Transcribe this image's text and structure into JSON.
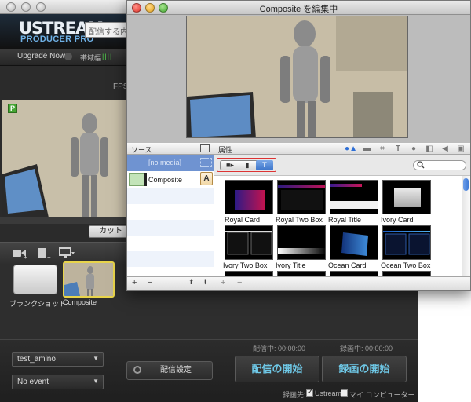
{
  "app": {
    "logo_main": "USTREAM",
    "logo_sub": "PRODUCER PRO",
    "broadcast_placeholder": "配信する内容",
    "upgrade_label": "Upgrade Now",
    "bandwidth_label": "帯域幅",
    "bandwidth_meter": "||||",
    "fps_label": "FPS:",
    "preview_badge": "P",
    "cut_label": "カット",
    "shots": [
      {
        "label": "ブランクショット"
      },
      {
        "label": "Composite"
      }
    ],
    "bottom": {
      "channel_select": "test_amino",
      "event_select": "No event",
      "settings_label": "配信設定",
      "stream_time": "配信中: 00:00:00",
      "record_time": "録画中: 00:00:00",
      "start_stream": "配信の開始",
      "start_record": "録画の開始",
      "dest_label": "録画先:",
      "dest_ustream": "Ustream",
      "dest_computer": "マイ コンピューター"
    }
  },
  "editor": {
    "title": "Composite を編集中",
    "source_header": "ソース",
    "attr_header": "属性",
    "sources": [
      {
        "label": "[no media]"
      },
      {
        "label": "Composite",
        "icon": "A"
      }
    ],
    "segments": [
      "camera-icon",
      "file-icon",
      "T"
    ],
    "templates": [
      {
        "label": "Royal Card",
        "style": "royal-card"
      },
      {
        "label": "Royal Two Box",
        "style": "royal-two-box"
      },
      {
        "label": "Royal Title",
        "style": "royal-title"
      },
      {
        "label": "Ivory Card",
        "style": "ivory-card"
      },
      {
        "label": "Ivory Two Box",
        "style": "ivory-two-box"
      },
      {
        "label": "Ivory Title",
        "style": "ivory-title"
      },
      {
        "label": "Ocean Card",
        "style": "ocean-card"
      },
      {
        "label": "Ocean Two Box",
        "style": "ocean-two-box"
      }
    ],
    "footer": {
      "add": "+",
      "remove": "−",
      "up": "⬆",
      "down": "⬇"
    }
  }
}
